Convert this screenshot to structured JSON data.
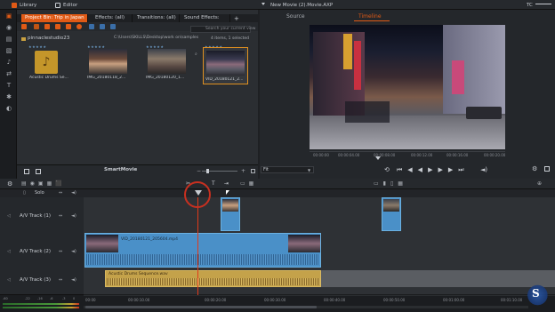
{
  "topbar": {
    "library_label": "Library",
    "editor_label": "Editor",
    "movie_title": "New Movie (2).Movie.AXP",
    "tc_label": "TC"
  },
  "library": {
    "tabs": [
      {
        "label": "Project Bin: Trip in Japan",
        "active": true
      },
      {
        "label": "Effects: (all)",
        "active": false
      },
      {
        "label": "Transitions: (all)",
        "active": false
      },
      {
        "label": "Sound Effects: (all)",
        "active": false
      }
    ],
    "folder": "pinnaclestudio23",
    "path": "C:\\Users\\SKILLS\\Desktop\\work on\\samples",
    "search_placeholder": "Search your current view",
    "count": "4 items, 1 selected",
    "items": [
      {
        "label": "Acustic Drums Se...",
        "kind": "audio"
      },
      {
        "label": "IMG_20180118_2...",
        "kind": "image"
      },
      {
        "label": "IMG_20180120_1...",
        "kind": "image"
      },
      {
        "label": "VID_20180121_2...",
        "kind": "video",
        "selected": true
      }
    ],
    "smartmovie_label": "SmartMovie"
  },
  "viewer": {
    "tabs": [
      {
        "label": "Source",
        "active": false
      },
      {
        "label": "Timeline",
        "active": true
      }
    ],
    "fit_label": "Fit",
    "ruler_labels": [
      "00:00:00",
      "00:00:04.00",
      "00:00:08.00",
      "00:00:12.00",
      "00:00:16.00",
      "00:00:20.00"
    ]
  },
  "timeline": {
    "solo_label": "Solo",
    "tracks": [
      {
        "label": "A/V Track (1)"
      },
      {
        "label": "A/V Track (2)"
      },
      {
        "label": "A/V Track (3)"
      }
    ],
    "video_clip_label": "VID_20180121_205604.mp4",
    "audio_clip_label": "Acustic Drums Sequence.wav",
    "ruler_labels": [
      "00:00",
      "00:00:10.00",
      "00:00:20.00",
      "00:00:30.00",
      "00:00:40.00",
      "00:00:50.00",
      "00:01:00.00",
      "00:01:10.00"
    ],
    "meter_labels": [
      "-60",
      "-22",
      "-16",
      "-6",
      "-3",
      "0"
    ]
  }
}
